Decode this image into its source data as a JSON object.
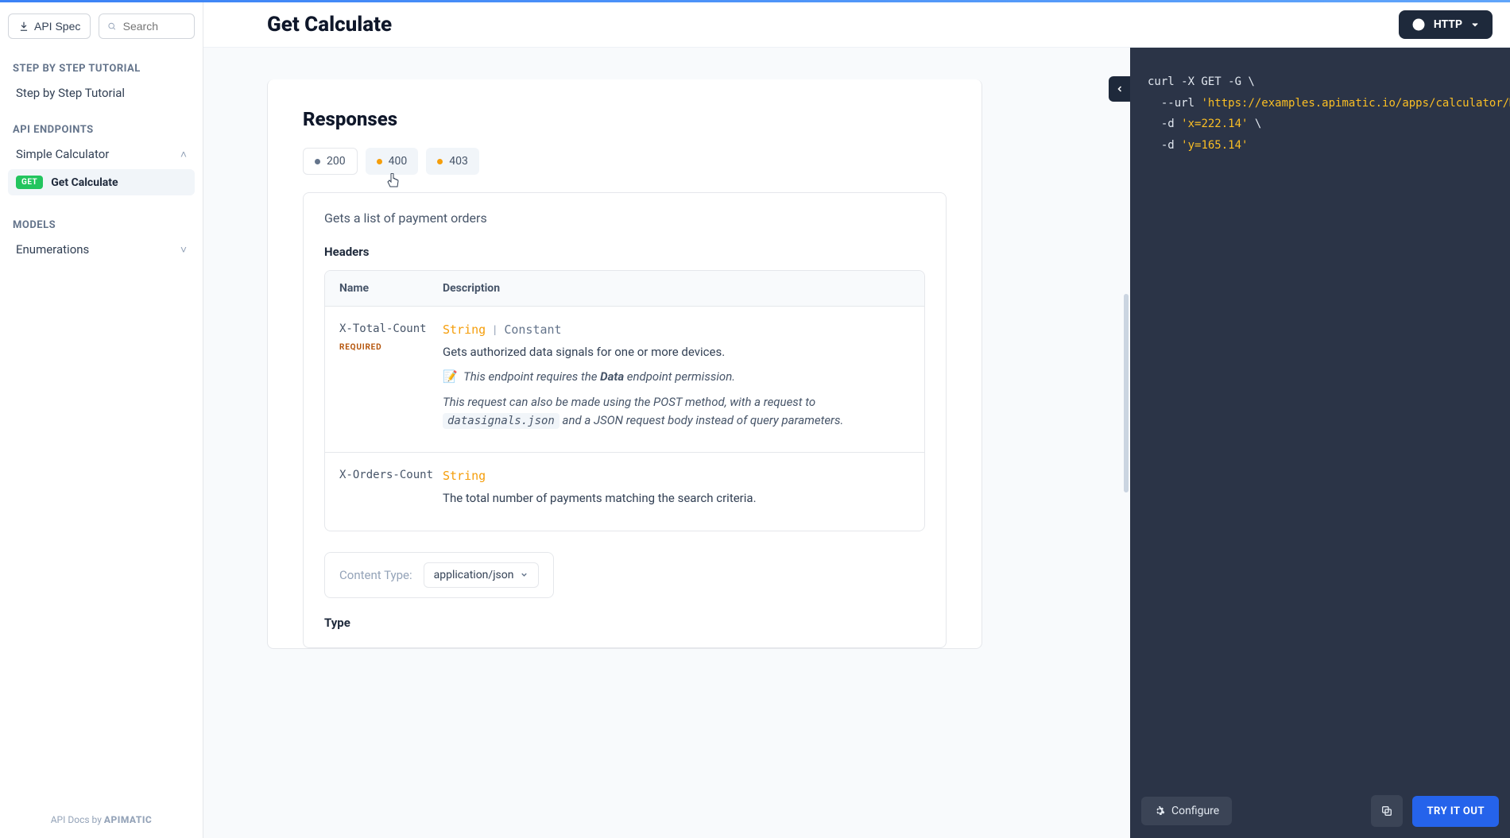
{
  "sidebar": {
    "api_spec_label": "API Spec",
    "search_placeholder": "Search",
    "sections": {
      "tutorial_heading": "STEP BY STEP TUTORIAL",
      "tutorial_item": "Step by Step Tutorial",
      "endpoints_heading": "API ENDPOINTS",
      "endpoints_group": "Simple Calculator",
      "endpoint_method": "GET",
      "endpoint_label": "Get Calculate",
      "models_heading": "MODELS",
      "models_item": "Enumerations"
    },
    "footer_prefix": "API Docs by ",
    "footer_brand": "APIMATIC"
  },
  "header": {
    "title": "Get Calculate",
    "protocol": "HTTP"
  },
  "responses": {
    "heading": "Responses",
    "tabs": [
      {
        "code": "200",
        "status_class": "ok"
      },
      {
        "code": "400",
        "status_class": "warn"
      },
      {
        "code": "403",
        "status_class": "warn"
      }
    ],
    "description": "Gets a list of payment orders",
    "headers_heading": "Headers",
    "table": {
      "col_name": "Name",
      "col_desc": "Description",
      "rows": [
        {
          "name": "X-Total-Count",
          "required": "REQUIRED",
          "type": "String",
          "constant": "Constant",
          "desc1": "Gets authorized data signals for one or more devices.",
          "note_emoji": "📝",
          "note_prefix": "This endpoint requires the ",
          "note_bold": "Data",
          "note_suffix": " endpoint permission.",
          "post_prefix": "This request can also be made using the POST method, with a request to ",
          "post_code": "datasignals.json",
          "post_suffix": " and a JSON request body instead of query parameters."
        },
        {
          "name": "X-Orders-Count",
          "type": "String",
          "desc1": "The total number of payments matching the search criteria."
        }
      ]
    },
    "content_type_label": "Content Type:",
    "content_type_value": "application/json",
    "type_label": "Type"
  },
  "code": {
    "l1_a": "curl -X GET -G \\",
    "l2_flag": "--url",
    "l2_url": "'https://examples.apimatic.io/apps/calculator/MULTI",
    "l3_flag": "-d",
    "l3_str": "'x=222.14'",
    "l3_tail": " \\",
    "l4_flag": "-d",
    "l4_str": "'y=165.14'",
    "configure": "Configure",
    "try": "TRY IT OUT"
  }
}
